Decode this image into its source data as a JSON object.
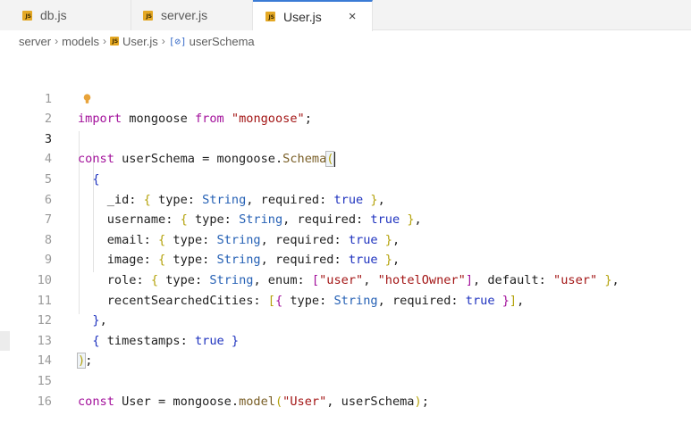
{
  "tabs": [
    {
      "label": "db.js",
      "icon": "js-file-icon"
    },
    {
      "label": "server.js",
      "icon": "js-file-icon"
    },
    {
      "label": "User.js",
      "icon": "js-file-icon",
      "active": true,
      "close": "×"
    }
  ],
  "breadcrumb": {
    "items": [
      "server",
      "models",
      "User.js",
      "userSchema"
    ],
    "separator": "›",
    "symbol_icon": "[⊘]"
  },
  "editor": {
    "active_line": 3,
    "lines": [
      {
        "n": "1",
        "text": "import mongoose from \"mongoose\";"
      },
      {
        "n": "2",
        "text": ""
      },
      {
        "n": "3",
        "text": "const userSchema = mongoose.Schema("
      },
      {
        "n": "4",
        "text": "  {"
      },
      {
        "n": "5",
        "text": "    _id: { type: String, required: true },"
      },
      {
        "n": "6",
        "text": "    username: { type: String, required: true },"
      },
      {
        "n": "7",
        "text": "    email: { type: String, required: true },"
      },
      {
        "n": "8",
        "text": "    image: { type: String, required: true },"
      },
      {
        "n": "9",
        "text": "    role: { type: String, enum: [\"user\", \"hotelOwner\"], default: \"user\" },"
      },
      {
        "n": "10",
        "text": "    recentSearchedCities: [{ type: String, required: true }],"
      },
      {
        "n": "11",
        "text": "  },"
      },
      {
        "n": "12",
        "text": "  { timestamps: true }"
      },
      {
        "n": "13",
        "text": ");"
      },
      {
        "n": "14",
        "text": ""
      },
      {
        "n": "15",
        "text": "const User = mongoose.model(\"User\", userSchema);"
      },
      {
        "n": "16",
        "text": ""
      }
    ]
  },
  "colors": {
    "keyword": "#a3119b",
    "string": "#a31515",
    "function": "#795e26",
    "boolean": "#1f33bf",
    "type": "#2661b5",
    "js_icon": "#e4a824",
    "active_tab_border": "#3a7bd5"
  },
  "icons": {
    "lightbulb": "lightbulb-icon"
  }
}
